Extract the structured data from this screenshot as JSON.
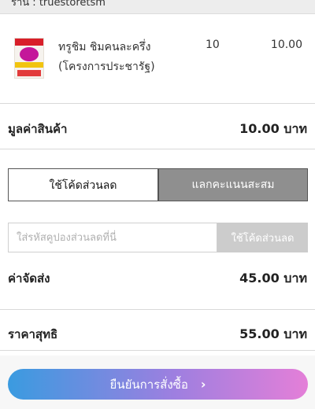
{
  "store": {
    "label": "ร้าน : truestoretsm"
  },
  "item": {
    "name": "ทรูชิม ชิมคนละครึ่ง (โครงการประชารัฐ)",
    "qty": "10",
    "price": "10.00"
  },
  "summary": {
    "subtotal_label": "มูลค่าสินค้า",
    "subtotal_value": "10.00 บาท",
    "shipping_label": "ค่าจัดส่ง",
    "shipping_value": "45.00 บาท",
    "total_label": "ราคาสุทธิ",
    "total_value": "55.00 บาท"
  },
  "tabs": [
    {
      "label": "ใช้โค้ดส่วนลด",
      "active": true
    },
    {
      "label": "แลกคะแนนสะสม",
      "active": false
    }
  ],
  "coupon": {
    "placeholder": "ใส่รหัสคูปองส่วนลดที่นี่",
    "button_label": "ใช้โค้ดส่วนลด"
  },
  "confirm": {
    "label": "ยืนยันการสั่งซื้อ",
    "icon": "chevron-right-icon"
  },
  "colors": {
    "tab_inactive": "#8f8f8f",
    "coupon_button": "#cccccc",
    "gradient_start": "#3a9be0",
    "gradient_end": "#e47fd8"
  }
}
